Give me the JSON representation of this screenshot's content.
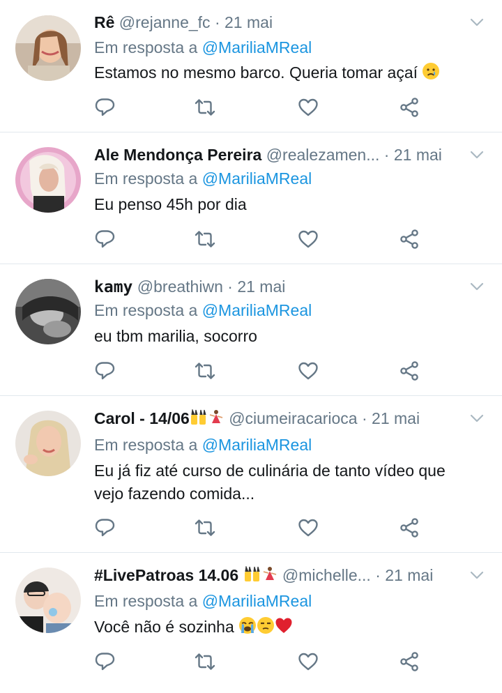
{
  "reply_prefix": "Em resposta a",
  "reply_target": "@MariliaMReal",
  "tweets": [
    {
      "name": "Rê",
      "handle": "@rejanne_fc",
      "date": "21 mai",
      "text": "Estamos no mesmo barco. Queria tomar açaí",
      "emoji": "crying-face"
    },
    {
      "name": "Ale Mendonça Pereira",
      "handle": "@realezamen...",
      "date": "21 mai",
      "text": "Eu penso 45h por dia"
    },
    {
      "name": "kamy",
      "handle": "@breathiwn",
      "date": "21 mai",
      "text": "eu tbm marilia, socorro"
    },
    {
      "name": "Carol - 14/06",
      "name_emoji": [
        "women-with-bunny-ears",
        "dancer"
      ],
      "handle": "@ciumeiracarioca",
      "date": "21 mai",
      "text_line1": "Eu já fiz até curso de culinária de tanto vídeo que",
      "text_line2": "vejo fazendo comida..."
    },
    {
      "name": "#LivePatroas 14.06",
      "name_emoji": [
        "women-with-bunny-ears",
        "dancer"
      ],
      "handle": "@michelle...",
      "date": "21 mai",
      "text": "Você não é sozinha",
      "emoji": [
        "loudly-crying-face",
        "unamused-face",
        "red-heart"
      ]
    }
  ],
  "colors": {
    "accent": "#1b95e0",
    "secondary_text": "#657786",
    "icon": "#657786",
    "divider": "#e1e8ed"
  }
}
